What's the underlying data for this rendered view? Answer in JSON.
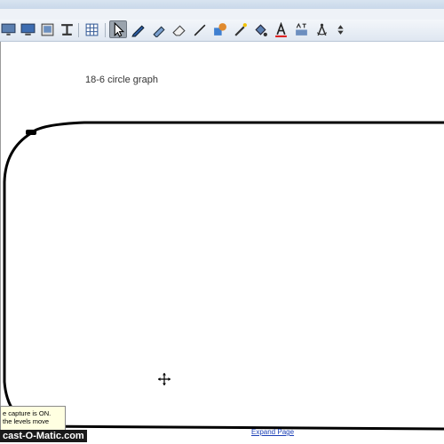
{
  "app": {
    "page_label": "18-6 circle graph",
    "expand_link": "Expand Page"
  },
  "toolbar": {
    "tools": [
      {
        "id": "monitor-a",
        "icon": "monitor-icon"
      },
      {
        "id": "monitor-b",
        "icon": "monitor-icon"
      },
      {
        "id": "picture",
        "icon": "picture-icon"
      },
      {
        "id": "clamp",
        "icon": "clamp-icon"
      },
      {
        "id": "table",
        "icon": "table-icon"
      },
      {
        "id": "select",
        "icon": "arrow-cursor-icon",
        "active": true
      },
      {
        "id": "pen",
        "icon": "pen-icon"
      },
      {
        "id": "highlighter",
        "icon": "highlighter-icon"
      },
      {
        "id": "eraser",
        "icon": "eraser-icon"
      },
      {
        "id": "line",
        "icon": "line-icon"
      },
      {
        "id": "shapes",
        "icon": "shapes-icon"
      },
      {
        "id": "magic-pen",
        "icon": "magic-pen-icon"
      },
      {
        "id": "fill",
        "icon": "fill-icon"
      },
      {
        "id": "text",
        "icon": "text-icon"
      },
      {
        "id": "image-text",
        "icon": "image-text-icon"
      },
      {
        "id": "compass",
        "icon": "compass-icon"
      },
      {
        "id": "more",
        "icon": "double-arrow-icon"
      }
    ]
  },
  "notice": {
    "line1": "e capture is ON.",
    "line2": "the levels move"
  },
  "watermark": "cast-O-Matic.com",
  "colors": {
    "toolbar_bg": "#e6ecf4",
    "active_tool": "#9aa3ad",
    "ink": "#000000",
    "notice_bg": "#ffffe1",
    "link": "#1b3fb5"
  }
}
